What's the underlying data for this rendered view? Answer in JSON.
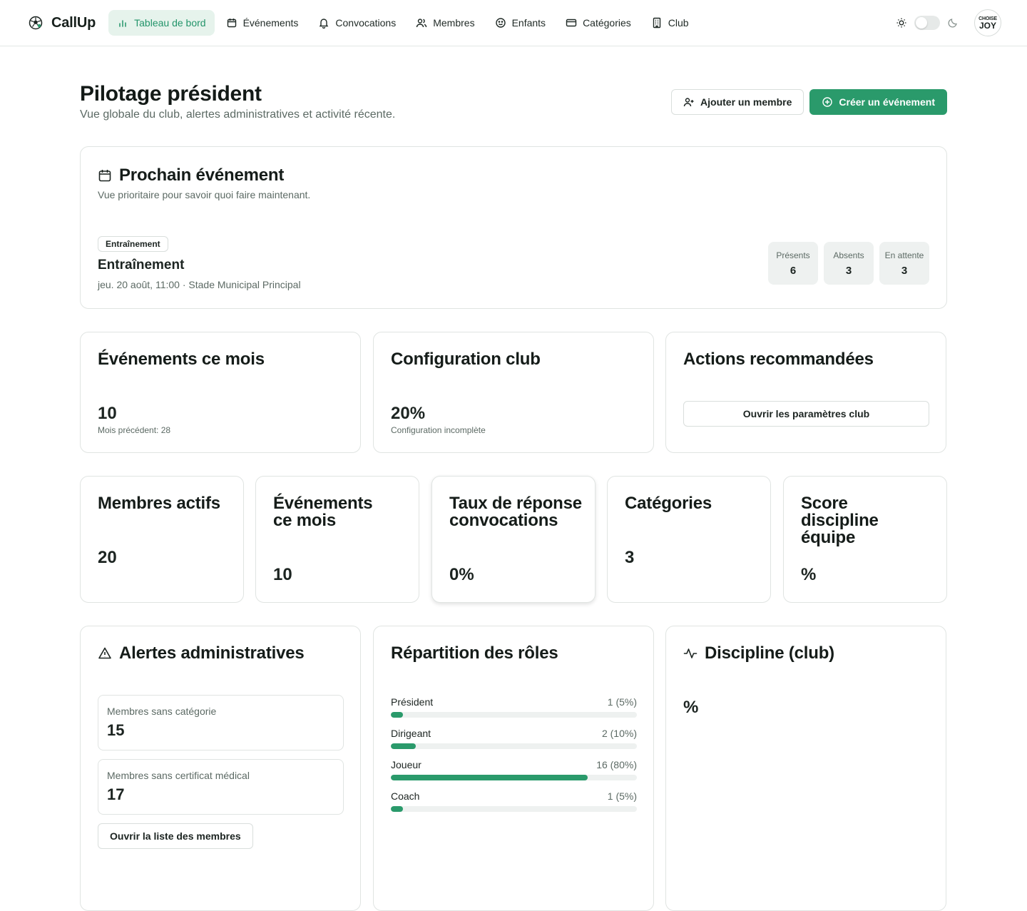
{
  "app": {
    "name": "CallUp"
  },
  "nav": {
    "items": [
      {
        "label": "Tableau de bord",
        "icon": "bar-chart-icon"
      },
      {
        "label": "Événements",
        "icon": "calendar-icon"
      },
      {
        "label": "Convocations",
        "icon": "bell-icon"
      },
      {
        "label": "Membres",
        "icon": "users-icon"
      },
      {
        "label": "Enfants",
        "icon": "smile-icon"
      },
      {
        "label": "Catégories",
        "icon": "card-icon"
      },
      {
        "label": "Club",
        "icon": "building-icon"
      }
    ],
    "active_index": 0
  },
  "user": {
    "avatar_line1": "CHOISE",
    "avatar_line2": "JOY"
  },
  "header": {
    "title": "Pilotage président",
    "subtitle": "Vue globale du club, alertes administratives et activité récente.",
    "add_member_label": "Ajouter un membre",
    "create_event_label": "Créer un événement"
  },
  "next_event": {
    "title": "Prochain événement",
    "description": "Vue prioritaire pour savoir quoi faire maintenant.",
    "badge": "Entraînement",
    "name": "Entraînement",
    "meta": "jeu. 20 août, 11:00 · Stade Municipal Principal",
    "stats": [
      {
        "label": "Présents",
        "value": "6"
      },
      {
        "label": "Absents",
        "value": "3"
      },
      {
        "label": "En attente",
        "value": "3"
      }
    ]
  },
  "overview": {
    "events_month": {
      "title": "Événements ce mois",
      "value": "10",
      "note": "Mois précédent: 28"
    },
    "club_config": {
      "title": "Configuration club",
      "value": "20%",
      "note": "Configuration incomplète"
    },
    "actions": {
      "title": "Actions recommandées",
      "button": "Ouvrir les paramètres club"
    }
  },
  "kpis": [
    {
      "title": "Membres actifs",
      "value": "20"
    },
    {
      "title": "Événements ce mois",
      "value": "10"
    },
    {
      "title": "Taux de réponse convocations",
      "value": "0%"
    },
    {
      "title": "Catégories",
      "value": "3"
    },
    {
      "title": "Score discipline équipe",
      "value": "%"
    }
  ],
  "alerts": {
    "title": "Alertes administratives",
    "items": [
      {
        "label": "Membres sans catégorie",
        "value": "15"
      },
      {
        "label": "Membres sans certificat médical",
        "value": "17"
      }
    ],
    "button": "Ouvrir la liste des membres"
  },
  "roles": {
    "title": "Répartition des rôles",
    "items": [
      {
        "label": "Président",
        "count": "1 (5%)",
        "percent": 5
      },
      {
        "label": "Dirigeant",
        "count": "2 (10%)",
        "percent": 10
      },
      {
        "label": "Joueur",
        "count": "16 (80%)",
        "percent": 80
      },
      {
        "label": "Coach",
        "count": "1 (5%)",
        "percent": 5
      }
    ]
  },
  "discipline": {
    "title": "Discipline (club)",
    "value": "%"
  },
  "colors": {
    "accent": "#2a9a6b",
    "accent_soft": "#e6f3ec",
    "muted": "#5c6a64",
    "border": "#e0e4e2"
  }
}
